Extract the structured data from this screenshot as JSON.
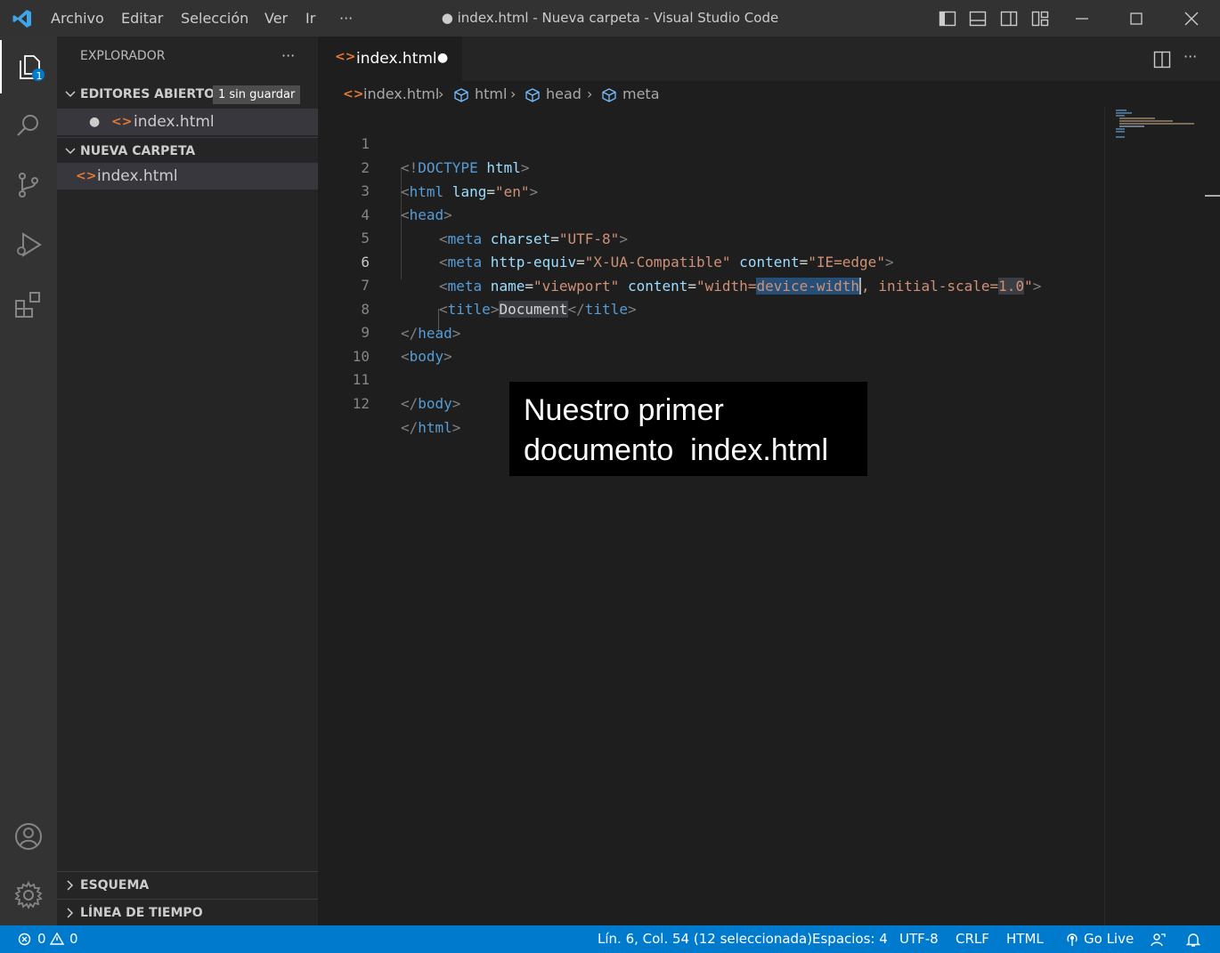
{
  "titlebar": {
    "menu": [
      "Archivo",
      "Editar",
      "Selección",
      "Ver",
      "Ir",
      "···"
    ],
    "title": "● index.html - Nueva carpeta - Visual Studio Code"
  },
  "activitybar": {
    "explorer_badge": "1",
    "items": [
      "explorer-icon",
      "search-icon",
      "source-control-icon",
      "run-debug-icon",
      "extensions-icon"
    ],
    "bottom": [
      "account-icon",
      "settings-gear-icon"
    ]
  },
  "sidebar": {
    "title": "EXPLORADOR",
    "more": "···",
    "open_editors": {
      "label": "EDITORES ABIERTOS",
      "badge": "1 sin guardar",
      "file": "index.html"
    },
    "folder": {
      "label": "NUEVA CARPETA",
      "file": "index.html"
    },
    "outline": "ESQUEMA",
    "timeline": "LÍNEA DE TIEMPO"
  },
  "editor": {
    "tab_label": "index.html",
    "tab_dirty": "●",
    "breadcrumb": [
      "index.html",
      "html",
      "head",
      "meta"
    ],
    "line_numbers": [
      "1",
      "2",
      "3",
      "4",
      "5",
      "6",
      "7",
      "8",
      "9",
      "10",
      "11",
      "12"
    ],
    "current_line": "6",
    "code": {
      "l1": {
        "open": "<!",
        "doctype": "DOCTYPE",
        "sp": " ",
        "html": "html",
        "close": ">"
      },
      "l2": {
        "open": "<",
        "tag": "html",
        "attr": " lang",
        "eq": "=",
        "val": "\"en\"",
        "close": ">"
      },
      "l3": {
        "open": "<",
        "tag": "head",
        "close": ">"
      },
      "l4": {
        "open": "<",
        "tag": "meta",
        "attr": " charset",
        "eq": "=",
        "val": "\"UTF-8\"",
        "close": ">"
      },
      "l5": {
        "open": "<",
        "tag": "meta",
        "attr1": " http-equiv",
        "eq1": "=",
        "val1": "\"X-UA-Compatible\"",
        "attr2": " content",
        "eq2": "=",
        "val2": "\"IE=edge\"",
        "close": ">"
      },
      "l6": {
        "open": "<",
        "tag": "meta",
        "attr1": " name",
        "eq1": "=",
        "val1": "\"viewport\"",
        "attr2": " content",
        "eq2": "=",
        "val2a": "\"width=",
        "val2sel": "device-width",
        "val2b": ", initial-scale=",
        "val2hl": "1.0",
        "val2c": "\"",
        "close": ">"
      },
      "l7": {
        "open": "<",
        "tag": "title",
        "close": ">",
        "text": "Document",
        "open2": "</",
        "tag2": "title",
        "close2": ">"
      },
      "l8": {
        "open": "</",
        "tag": "head",
        "close": ">"
      },
      "l9": {
        "open": "<",
        "tag": "body",
        "close": ">"
      },
      "l11": {
        "open": "</",
        "tag": "body",
        "close": ">"
      },
      "l12": {
        "open": "</",
        "tag": "html",
        "close": ">"
      }
    }
  },
  "caption": {
    "line1": "Nuestro primer",
    "line2": "documento  index.html"
  },
  "statusbar": {
    "errors": "0",
    "warnings": "0",
    "position": "Lín. 6, Col. 54 (12 seleccionada)",
    "spaces": "Espacios: 4",
    "encoding": "UTF-8",
    "eol": "CRLF",
    "language": "HTML",
    "golive": "Go Live"
  },
  "colors": {
    "accent": "#007acc",
    "titlebar": "#323233",
    "activitybar": "#333333",
    "sidebar": "#252526",
    "editor": "#1e1e1e"
  }
}
